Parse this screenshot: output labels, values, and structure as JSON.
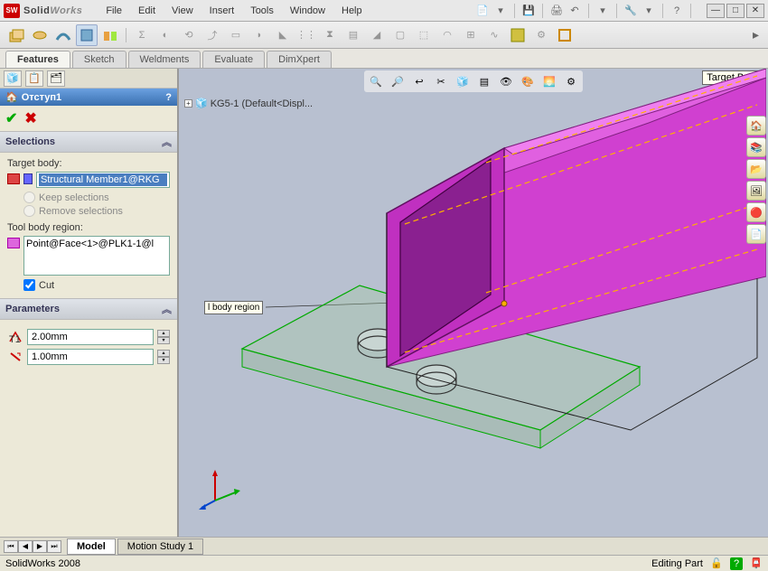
{
  "app": {
    "name_solid": "Solid",
    "name_works": "Works"
  },
  "menus": [
    "File",
    "Edit",
    "View",
    "Insert",
    "Tools",
    "Window",
    "Help"
  ],
  "cmd_tabs": [
    "Features",
    "Sketch",
    "Weldments",
    "Evaluate",
    "DimXpert"
  ],
  "cmd_active": 0,
  "tree_fly": "KG5-1  (Default<Displ...",
  "target_body_tooltip": "Target Body",
  "callout_body_region": "l body region",
  "feature": {
    "title": "Отступ1",
    "help": "?",
    "selections_label": "Selections",
    "target_body_label": "Target body:",
    "target_body_value": "Structural Member1@RKG",
    "keep_selections": "Keep selections",
    "remove_selections": "Remove selections",
    "tool_body_label": "Tool body region:",
    "tool_body_value": "Point@Face<1>@PLK1-1@l",
    "cut_label": "Cut",
    "cut_checked": true,
    "parameters_label": "Parameters",
    "param1_value": "2.00mm",
    "param2_value": "1.00mm"
  },
  "bottom_tabs": [
    "Model",
    "Motion Study 1"
  ],
  "bottom_active": 0,
  "status": {
    "left": "SolidWorks 2008",
    "mode": "Editing Part"
  }
}
